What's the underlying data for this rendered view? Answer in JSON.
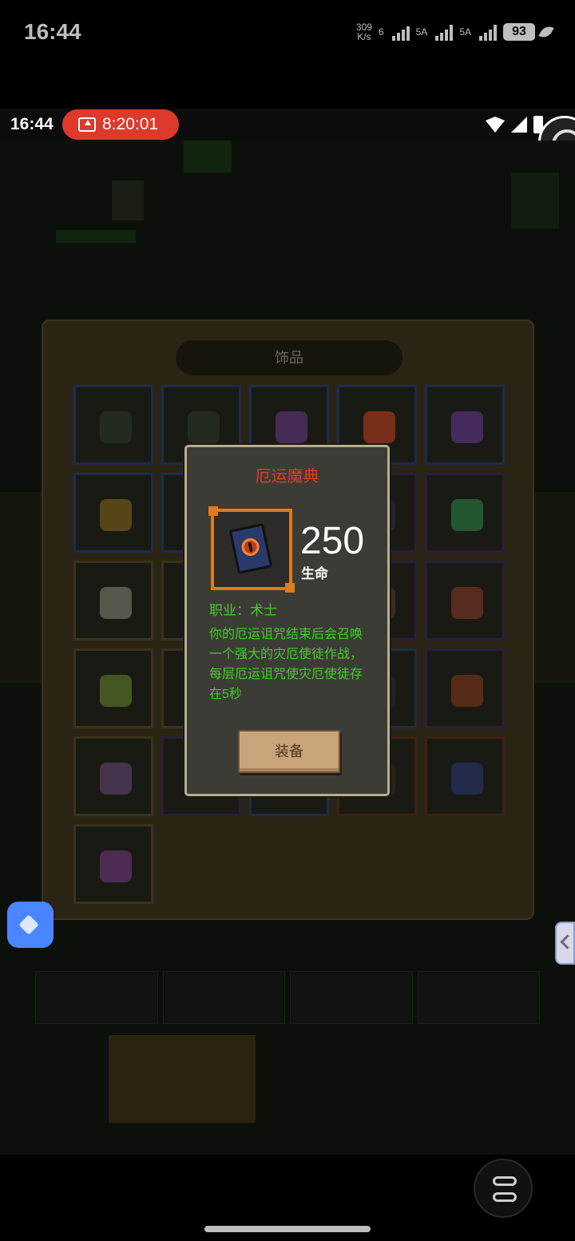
{
  "status_bar": {
    "time": "16:44",
    "net_speed_value": "309",
    "net_speed_unit": "K/s",
    "wifi_label": "6",
    "sim1_label": "5A",
    "sim2_label": "5A",
    "battery": "93"
  },
  "recording_bar": {
    "time": "16:44",
    "elapsed": "8:20:01"
  },
  "inventory": {
    "title": "饰品",
    "slots": [
      {
        "frame": "blue",
        "icon_color": "#2c3a2a"
      },
      {
        "frame": "blue",
        "icon_color": "#2c3a2a"
      },
      {
        "frame": "blue",
        "icon_color": "#6b3a8a"
      },
      {
        "frame": "blue",
        "icon_color": "#c8401e"
      },
      {
        "frame": "blue",
        "icon_color": "#6b3a9a"
      },
      {
        "frame": "blue",
        "icon_color": "#8a6a1e"
      },
      {
        "frame": "blue",
        "icon_color": "#8a2a1a"
      },
      {
        "frame": "yellow",
        "icon_color": "#4a3a1a"
      },
      {
        "frame": "purple",
        "icon_color": "#3a2a4a"
      },
      {
        "frame": "purple",
        "icon_color": "#2a8a4a"
      },
      {
        "frame": "yellow",
        "icon_color": "#8a8a7a"
      },
      {
        "frame": "yellow",
        "icon_color": "#6a5a2a"
      },
      {
        "frame": "yellow",
        "icon_color": "#3a3a2a"
      },
      {
        "frame": "purple",
        "icon_color": "#5a3a2a"
      },
      {
        "frame": "purple",
        "icon_color": "#8a3a2a"
      },
      {
        "frame": "yellow",
        "icon_color": "#6a8a2a"
      },
      {
        "frame": "yellow",
        "icon_color": "#4a4a2a"
      },
      {
        "frame": "yellow",
        "icon_color": "#3a3a2a"
      },
      {
        "frame": "blue",
        "icon_color": "#2a2a3a"
      },
      {
        "frame": "purple",
        "icon_color": "#8a3a1a"
      },
      {
        "frame": "yellow",
        "icon_color": "#6a4a7a"
      },
      {
        "frame": "purple",
        "icon_color": "#3a2a4a"
      },
      {
        "frame": "blue",
        "icon_color": "#2a2a3a"
      },
      {
        "frame": "orange",
        "icon_color": "#3a2a1a"
      },
      {
        "frame": "orange",
        "icon_color": "#2a3a7a"
      },
      {
        "frame": "yellow",
        "icon_color": "#7a3a8a"
      }
    ]
  },
  "item_popup": {
    "title": "厄运魔典",
    "stat_value": "250",
    "stat_label": "生命",
    "class_line": "职业：术士",
    "description": "你的厄运诅咒结束后会召唤一个强大的灾厄使徒作战，每层厄运诅咒使灾厄使徒存在5秒",
    "equip_button": "装备"
  },
  "colors": {
    "popup_title": "#e23c21",
    "description_text": "#40d024",
    "rec_pill": "#dd3a2c",
    "item_frame": "#e07a1a"
  }
}
